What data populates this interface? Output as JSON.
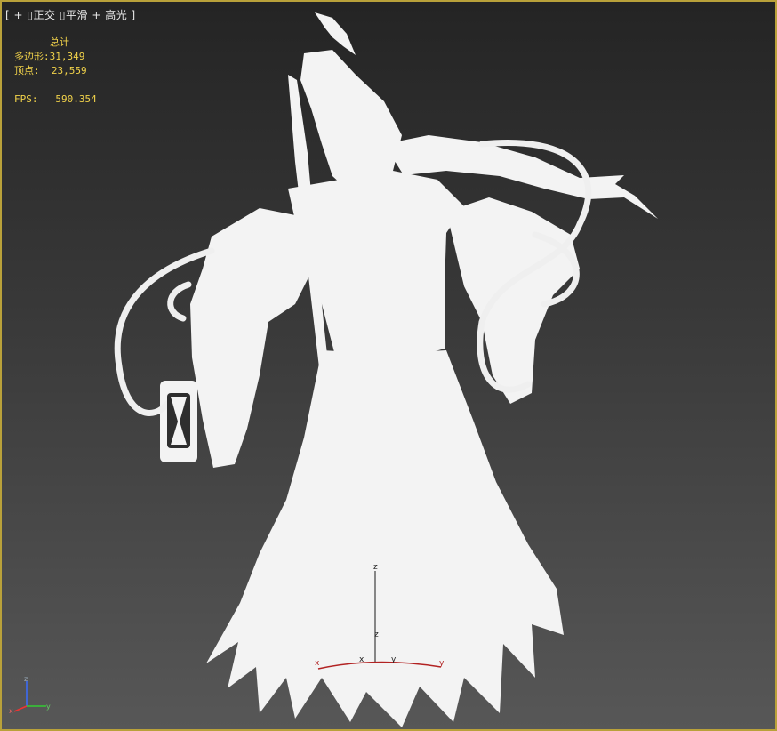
{
  "viewport": {
    "label": {
      "open_bracket": "[",
      "plus": "+",
      "sep1": "▯",
      "view": "正交",
      "sep2": "▯",
      "shading": "平滑",
      "plus2": "+",
      "highlight": "高光",
      "close_bracket": "]"
    },
    "stats": {
      "title": "总计",
      "polygons_label": "多边形:",
      "polygons_value": "31,349",
      "vertices_label": "顶点:",
      "vertices_value": "23,559",
      "fps_label": "FPS:",
      "fps_value": "590.354"
    },
    "gizmo_labels": {
      "z_top": "z",
      "z_mid": "z",
      "x_left": "x",
      "x_mid": "x",
      "y_mid": "y",
      "y_right": "y"
    },
    "axis_tripod": {
      "x": "x",
      "y": "y",
      "z": "z"
    }
  }
}
